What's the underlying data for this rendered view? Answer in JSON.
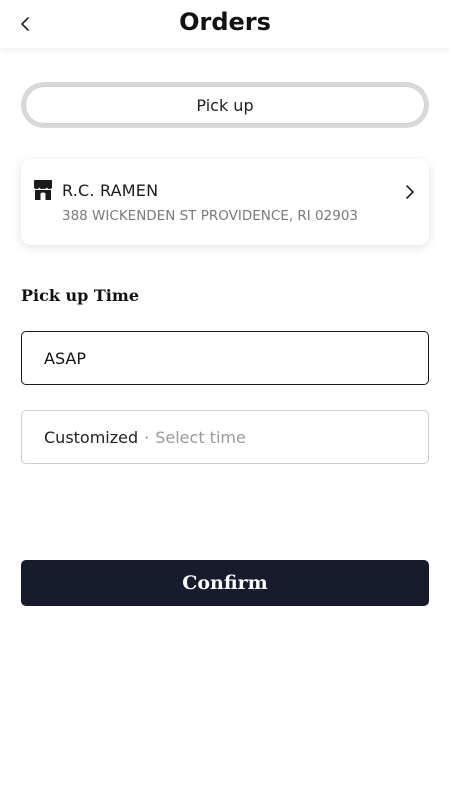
{
  "header": {
    "title": "Orders",
    "back_icon": "chevron-left-icon"
  },
  "fulfillment": {
    "selected_label": "Pick up"
  },
  "store": {
    "icon": "storefront-icon",
    "name": "R.C. RAMEN",
    "address": "388 WICKENDEN ST PROVIDENCE, RI 02903",
    "chevron_icon": "chevron-right-icon"
  },
  "pickup_time": {
    "label": "Pick up Time",
    "options": [
      {
        "label": "ASAP",
        "selected": true
      },
      {
        "label": "Customized",
        "separator": "·",
        "placeholder": "Select time",
        "selected": false
      }
    ]
  },
  "confirm_label": "Confirm",
  "colors": {
    "primary_button": "#181b2e",
    "selected_border": "#1a1a1a",
    "unselected_border": "#cfcfcf",
    "muted_text": "#7a7a7a"
  }
}
